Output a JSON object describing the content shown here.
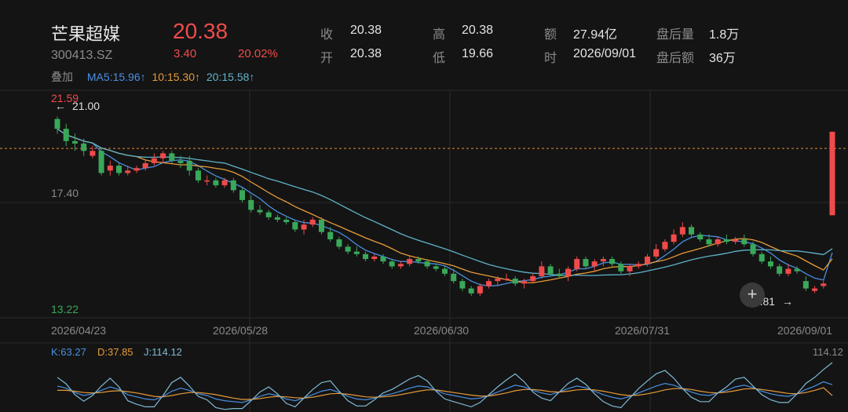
{
  "header": {
    "name": "芒果超媒",
    "code": "300413.SZ",
    "price": "20.38",
    "change": "3.40",
    "change_pct": "20.02%",
    "quote": [
      {
        "label": "收",
        "value": "20.38"
      },
      {
        "label": "开",
        "value": "20.38"
      },
      {
        "label": "高",
        "value": "20.38"
      },
      {
        "label": "低",
        "value": "19.66"
      },
      {
        "label": "额",
        "value": "27.94亿"
      },
      {
        "label": "时",
        "value": "2026/09/01"
      },
      {
        "label": "盘后量",
        "value": "1.8万"
      },
      {
        "label": "盘后额",
        "value": "36万"
      }
    ]
  },
  "ma_bar": {
    "overlay": "叠加",
    "ma5": "MA5:15.96↑",
    "ma10": "10:15.30↑",
    "ma20": "20:15.58↑"
  },
  "colors": {
    "up": "#ef4b4b",
    "down": "#3aa85a",
    "ma5": "#4a90e2",
    "ma10": "#e69b3a",
    "ma20": "#5fb3c9",
    "k": "#4a90e2",
    "d": "#e69b3a",
    "j": "#7fb9d6"
  },
  "chart_data": {
    "type": "candlestick",
    "price_axis_labels": [
      "21.59",
      "17.40",
      "13.22"
    ],
    "y_range": [
      13.22,
      21.59
    ],
    "dates": [
      "2026/04/23",
      "2026/05/28",
      "2026/06/30",
      "2026/07/31",
      "2026/09/01"
    ],
    "max_marker": "21.00",
    "min_marker": "13.81",
    "reference_price": 19.7,
    "candles": [
      [
        20.9,
        21.0,
        20.3,
        20.5
      ],
      [
        20.5,
        20.7,
        19.8,
        20.0
      ],
      [
        20.0,
        20.3,
        19.6,
        19.9
      ],
      [
        19.9,
        20.1,
        19.4,
        19.6
      ],
      [
        19.4,
        19.8,
        19.3,
        19.6
      ],
      [
        19.6,
        19.7,
        18.6,
        18.7
      ],
      [
        18.8,
        19.2,
        18.6,
        19.0
      ],
      [
        19.0,
        19.1,
        18.6,
        18.7
      ],
      [
        18.7,
        19.0,
        18.6,
        18.8
      ],
      [
        18.8,
        19.0,
        18.7,
        18.9
      ],
      [
        18.9,
        19.2,
        18.8,
        19.1
      ],
      [
        19.1,
        19.5,
        19.0,
        19.3
      ],
      [
        19.3,
        19.6,
        19.1,
        19.5
      ],
      [
        19.5,
        19.6,
        19.1,
        19.2
      ],
      [
        19.2,
        19.4,
        18.9,
        19.1
      ],
      [
        19.2,
        19.4,
        18.6,
        18.8
      ],
      [
        18.8,
        18.9,
        18.3,
        18.4
      ],
      [
        18.4,
        18.6,
        18.2,
        18.4
      ],
      [
        18.4,
        18.5,
        18.1,
        18.2
      ],
      [
        18.2,
        18.5,
        18.1,
        18.4
      ],
      [
        18.4,
        18.5,
        17.9,
        18.0
      ],
      [
        18.0,
        18.1,
        17.5,
        17.6
      ],
      [
        17.6,
        17.8,
        17.1,
        17.2
      ],
      [
        17.2,
        17.4,
        17.0,
        17.1
      ],
      [
        17.1,
        17.2,
        16.8,
        16.9
      ],
      [
        16.9,
        17.0,
        16.7,
        16.8
      ],
      [
        16.8,
        16.9,
        16.6,
        16.7
      ],
      [
        16.7,
        16.8,
        16.3,
        16.4
      ],
      [
        16.4,
        16.8,
        16.2,
        16.6
      ],
      [
        16.6,
        16.9,
        16.5,
        16.8
      ],
      [
        16.8,
        16.9,
        16.2,
        16.3
      ],
      [
        16.3,
        16.5,
        15.9,
        16.0
      ],
      [
        16.0,
        16.1,
        15.6,
        15.7
      ],
      [
        15.7,
        15.8,
        15.4,
        15.5
      ],
      [
        15.5,
        15.7,
        15.3,
        15.4
      ],
      [
        15.4,
        15.5,
        15.1,
        15.2
      ],
      [
        15.2,
        15.4,
        15.1,
        15.3
      ],
      [
        15.3,
        15.4,
        15.0,
        15.1
      ],
      [
        15.1,
        15.2,
        14.8,
        14.9
      ],
      [
        14.9,
        15.1,
        14.8,
        15.0
      ],
      [
        15.0,
        15.3,
        14.9,
        15.2
      ],
      [
        15.2,
        15.3,
        15.0,
        15.1
      ],
      [
        15.1,
        15.2,
        14.8,
        14.9
      ],
      [
        14.9,
        15.0,
        14.7,
        14.8
      ],
      [
        14.8,
        14.9,
        14.5,
        14.6
      ],
      [
        14.6,
        14.8,
        14.2,
        14.3
      ],
      [
        14.3,
        14.4,
        13.9,
        14.0
      ],
      [
        14.0,
        14.1,
        13.7,
        13.8
      ],
      [
        13.8,
        14.2,
        13.7,
        14.1
      ],
      [
        14.1,
        14.4,
        14.0,
        14.3
      ],
      [
        14.3,
        14.5,
        14.1,
        14.4
      ],
      [
        14.4,
        14.6,
        14.3,
        14.4
      ],
      [
        14.4,
        14.5,
        14.1,
        14.2
      ],
      [
        14.2,
        14.4,
        14.0,
        14.3
      ],
      [
        14.3,
        14.6,
        14.2,
        14.5
      ],
      [
        14.5,
        15.1,
        14.4,
        14.9
      ],
      [
        14.9,
        15.0,
        14.5,
        14.6
      ],
      [
        14.6,
        14.8,
        14.4,
        14.5
      ],
      [
        14.5,
        14.9,
        14.3,
        14.8
      ],
      [
        14.8,
        15.3,
        14.7,
        15.2
      ],
      [
        15.2,
        15.3,
        14.8,
        14.9
      ],
      [
        14.9,
        15.2,
        14.7,
        15.1
      ],
      [
        15.1,
        15.3,
        14.9,
        15.2
      ],
      [
        15.2,
        15.3,
        14.9,
        15.0
      ],
      [
        15.0,
        15.1,
        14.6,
        14.7
      ],
      [
        14.7,
        15.0,
        14.5,
        14.9
      ],
      [
        14.9,
        15.1,
        14.8,
        15.0
      ],
      [
        15.0,
        15.4,
        14.9,
        15.3
      ],
      [
        15.3,
        15.8,
        15.2,
        15.6
      ],
      [
        15.6,
        16.0,
        15.5,
        15.9
      ],
      [
        15.9,
        16.4,
        15.8,
        16.2
      ],
      [
        16.2,
        16.7,
        16.1,
        16.5
      ],
      [
        16.5,
        16.6,
        16.1,
        16.2
      ],
      [
        16.2,
        16.3,
        15.9,
        16.0
      ],
      [
        16.0,
        16.2,
        15.7,
        15.8
      ],
      [
        15.8,
        16.1,
        15.7,
        16.0
      ],
      [
        16.0,
        16.2,
        15.8,
        15.9
      ],
      [
        15.9,
        16.1,
        15.8,
        16.0
      ],
      [
        16.0,
        16.2,
        15.7,
        15.8
      ],
      [
        15.8,
        15.9,
        15.3,
        15.4
      ],
      [
        15.4,
        15.5,
        15.0,
        15.1
      ],
      [
        15.1,
        15.3,
        14.8,
        14.9
      ],
      [
        14.9,
        15.0,
        14.5,
        14.6
      ],
      [
        14.6,
        15.0,
        14.5,
        14.8
      ],
      [
        14.8,
        14.9,
        14.6,
        14.7
      ],
      [
        14.3,
        14.5,
        13.9,
        14.0
      ],
      [
        13.9,
        14.1,
        13.81,
        14.0
      ],
      [
        14.1,
        14.3,
        14.0,
        14.2
      ],
      [
        16.98,
        20.38,
        16.98,
        20.38
      ]
    ]
  },
  "kdj": {
    "k": "K:63.27",
    "d": "D:37.85",
    "j": "J:114.12",
    "max_label": "114.12",
    "k_values": [
      60,
      55,
      45,
      38,
      42,
      50,
      58,
      52,
      40,
      35,
      30,
      28,
      36,
      48,
      55,
      50,
      42,
      38,
      30,
      26,
      24,
      22,
      28,
      36,
      42,
      38,
      30,
      26,
      32,
      40,
      48,
      52,
      45,
      36,
      30,
      28,
      32,
      38,
      42,
      48,
      55,
      60,
      58,
      50,
      42,
      38,
      34,
      30,
      32,
      38,
      46,
      54,
      62,
      58,
      50,
      44,
      40,
      46,
      54,
      60,
      56,
      48,
      40,
      34,
      30,
      36,
      44,
      52,
      60,
      66,
      62,
      54,
      46,
      40,
      38,
      44,
      50,
      58,
      62,
      56,
      48,
      42,
      38,
      36,
      42,
      52,
      60,
      70,
      63
    ],
    "d_values": [
      50,
      50,
      48,
      45,
      44,
      45,
      48,
      49,
      47,
      44,
      40,
      36,
      35,
      38,
      42,
      45,
      45,
      43,
      40,
      36,
      32,
      29,
      29,
      31,
      34,
      36,
      35,
      33,
      32,
      34,
      38,
      42,
      43,
      41,
      38,
      35,
      34,
      35,
      37,
      40,
      44,
      48,
      51,
      51,
      48,
      45,
      42,
      39,
      37,
      37,
      40,
      44,
      49,
      52,
      52,
      50,
      47,
      46,
      48,
      51,
      52,
      51,
      48,
      44,
      40,
      38,
      39,
      42,
      46,
      51,
      54,
      54,
      52,
      48,
      45,
      44,
      46,
      49,
      53,
      54,
      52,
      49,
      46,
      43,
      42,
      45,
      50,
      56,
      37.85
    ],
    "j_values": [
      80,
      65,
      40,
      25,
      38,
      60,
      78,
      58,
      26,
      18,
      12,
      12,
      38,
      68,
      80,
      60,
      36,
      28,
      10,
      6,
      8,
      8,
      26,
      46,
      58,
      42,
      20,
      12,
      32,
      52,
      68,
      72,
      48,
      26,
      14,
      14,
      28,
      44,
      52,
      64,
      76,
      84,
      72,
      48,
      30,
      24,
      18,
      12,
      22,
      40,
      58,
      74,
      88,
      70,
      46,
      32,
      26,
      46,
      66,
      78,
      64,
      42,
      24,
      14,
      10,
      32,
      54,
      72,
      88,
      96,
      78,
      54,
      34,
      24,
      24,
      44,
      58,
      76,
      80,
      60,
      40,
      28,
      22,
      22,
      42,
      66,
      80,
      98,
      114.12
    ]
  }
}
